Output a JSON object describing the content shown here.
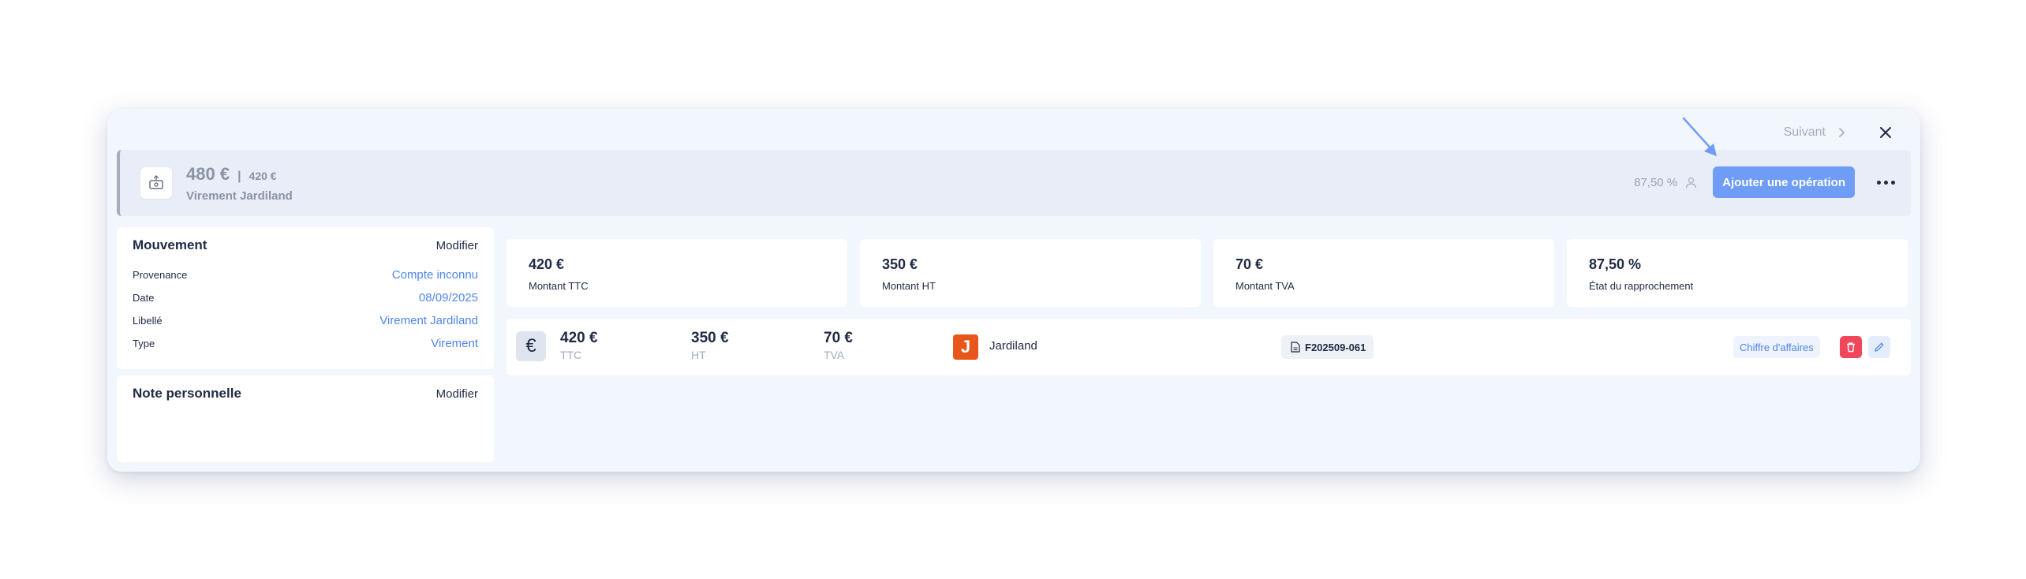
{
  "nav": {
    "next_label": "Suivant",
    "next_icon": "chevron-right-icon",
    "close_icon": "close-icon"
  },
  "header": {
    "icon": "bank-transfer-icon",
    "amount_main": "480 €",
    "separator": "|",
    "amount_sub": "420 €",
    "label": "Virement Jardiland",
    "percent": "87,50 %",
    "user_icon": "user-icon",
    "add_button": "Ajouter une opération",
    "more_icon": "more-horizontal-icon"
  },
  "mouvement": {
    "title": "Mouvement",
    "edit_label": "Modifier",
    "rows": [
      {
        "key": "Provenance",
        "value": "Compte inconnu"
      },
      {
        "key": "Date",
        "value": "08/09/2025"
      },
      {
        "key": "Libellé",
        "value": "Virement Jardiland"
      },
      {
        "key": "Type",
        "value": "Virement"
      }
    ]
  },
  "note": {
    "title": "Note personnelle",
    "edit_label": "Modifier"
  },
  "stats": [
    {
      "value": "420 €",
      "label": "Montant TTC"
    },
    {
      "value": "350 €",
      "label": "Montant HT"
    },
    {
      "value": "70 €",
      "label": "Montant TVA"
    },
    {
      "value": "87,50 %",
      "label": "État du rapprochement"
    }
  ],
  "operation": {
    "currency_symbol": "€",
    "ttc": {
      "value": "420 €",
      "label": "TTC"
    },
    "ht": {
      "value": "350 €",
      "label": "HT"
    },
    "tva": {
      "value": "70 €",
      "label": "TVA"
    },
    "merchant_logo": "J",
    "merchant": "Jardiland",
    "document": "F202509-061",
    "category": "Chiffre d'affaires",
    "delete_icon": "trash-icon",
    "edit_icon": "pencil-icon"
  },
  "colors": {
    "accent": "#6e9cf6",
    "link": "#4f86ec",
    "danger": "#f0475b",
    "background": "#f2f6fd",
    "merchant_brand": "#e8561b"
  }
}
